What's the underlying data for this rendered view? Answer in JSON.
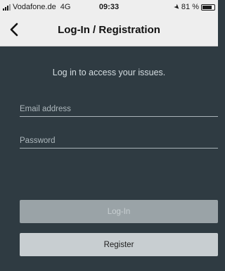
{
  "status_bar": {
    "carrier": "Vodafone.de",
    "network": "4G",
    "time": "09:33",
    "battery_text": "81 %",
    "battery_level": 0.81
  },
  "nav": {
    "title": "Log-In / Registration",
    "back_icon": "chevron-left-icon"
  },
  "main": {
    "prompt": "Log in to access your issues.",
    "email_placeholder": "Email address",
    "email_value": "",
    "password_placeholder": "Password",
    "password_value": "",
    "login_label": "Log-In",
    "register_label": "Register"
  },
  "colors": {
    "background": "#2f3b42",
    "header": "#eeeeee",
    "login_button": "#9aa3a7",
    "register_button": "#c8ced1"
  }
}
